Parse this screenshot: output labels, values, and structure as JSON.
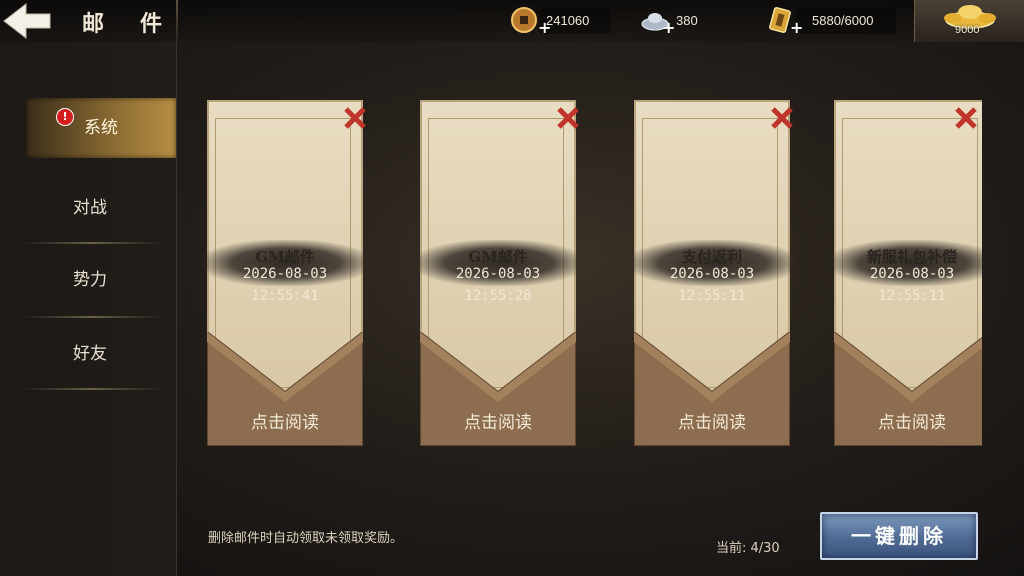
{
  "header": {
    "title": "邮件",
    "resources": {
      "copper": "241060",
      "silver": "380",
      "stamina": "5880/6000",
      "gold": "9000"
    }
  },
  "sidebar": {
    "items": [
      {
        "label": "系统",
        "active": true,
        "badge": "!"
      },
      {
        "label": "对战"
      },
      {
        "label": "势力"
      },
      {
        "label": "好友"
      }
    ]
  },
  "mails": [
    {
      "title": "GM邮件",
      "date": "2026-08-03",
      "time": "12:55:41",
      "action": "点击阅读"
    },
    {
      "title": "GM邮件",
      "date": "2026-08-03",
      "time": "12:55:28",
      "action": "点击阅读"
    },
    {
      "title": "支付返利",
      "date": "2026-08-03",
      "time": "12:55:11",
      "action": "点击阅读"
    },
    {
      "title": "新服礼包补偿",
      "date": "2026-08-03",
      "time": "12:55:11",
      "action": "点击阅读"
    }
  ],
  "footer": {
    "note": "删除邮件时自动领取未领取奖励。",
    "page_count": "当前: 4/30",
    "delete_all_label": "一键删除"
  },
  "colors": {
    "accent_gold": "#b98f46",
    "delete_button": "#4f6a93",
    "badge_red": "#d41e1e"
  }
}
